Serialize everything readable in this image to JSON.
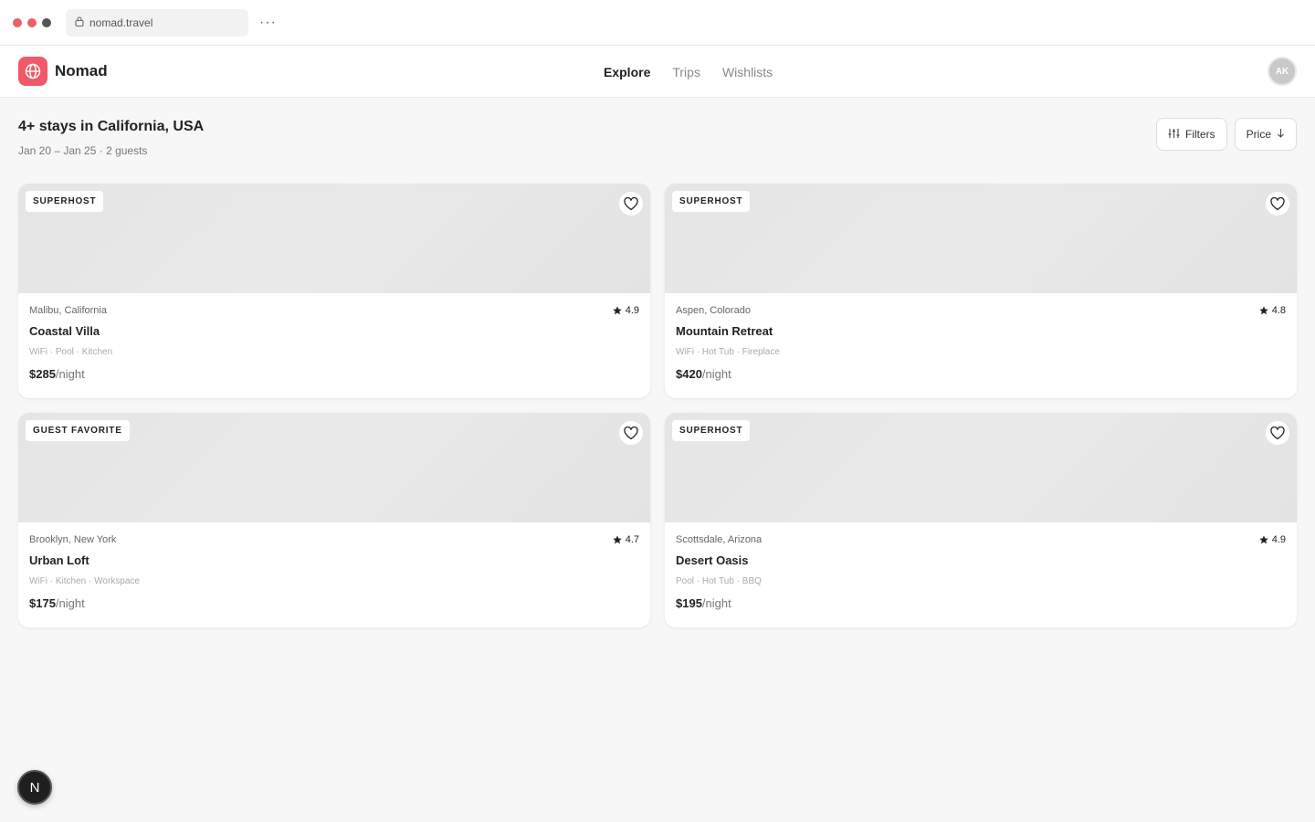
{
  "browser": {
    "url": "nomad.travel",
    "more_label": "···",
    "dot_colors": [
      "#ec5f67",
      "#ec5f67",
      "#555555"
    ]
  },
  "header": {
    "app_name": "Nomad",
    "brand_color": "#ee5a67",
    "nav": [
      {
        "label": "Explore",
        "active": true
      },
      {
        "label": "Trips",
        "active": false
      },
      {
        "label": "Wishlists",
        "active": false
      }
    ],
    "avatar_initials": "AK"
  },
  "main": {
    "title": "4+ stays in California, USA",
    "subtitle": "Jan 20 – Jan 25 · 2 guests",
    "filters_label": "Filters",
    "sort_label": "Price"
  },
  "listings": [
    {
      "badge": "SUPERHOST",
      "location": "Malibu, California",
      "rating": "4.9",
      "name": "Coastal Villa",
      "amenities": "WiFi · Pool · Kitchen",
      "price": "$285",
      "unit": "/night"
    },
    {
      "badge": "SUPERHOST",
      "location": "Aspen, Colorado",
      "rating": "4.8",
      "name": "Mountain Retreat",
      "amenities": "WiFi · Hot Tub · Fireplace",
      "price": "$420",
      "unit": "/night"
    },
    {
      "badge": "GUEST FAVORITE",
      "location": "Brooklyn, New York",
      "rating": "4.7",
      "name": "Urban Loft",
      "amenities": "WiFi · Kitchen · Workspace",
      "price": "$175",
      "unit": "/night"
    },
    {
      "badge": "SUPERHOST",
      "location": "Scottsdale, Arizona",
      "rating": "4.9",
      "name": "Desert Oasis",
      "amenities": "Pool · Hot Tub · BBQ",
      "price": "$195",
      "unit": "/night"
    }
  ],
  "dev_badge": "N"
}
